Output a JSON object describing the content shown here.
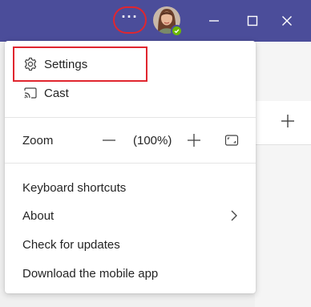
{
  "titlebar": {
    "more_options": "···",
    "avatar": "user-avatar",
    "status": "available"
  },
  "menu": {
    "settings": "Settings",
    "cast": "Cast",
    "zoom_label": "Zoom",
    "zoom_value": "(100%)",
    "keyboard_shortcuts": "Keyboard shortcuts",
    "about": "About",
    "check_updates": "Check for updates",
    "download_mobile": "Download the mobile app"
  },
  "colors": {
    "titlebar": "#4b4d9a",
    "highlight": "#e0262f",
    "status": "#6bb700"
  }
}
